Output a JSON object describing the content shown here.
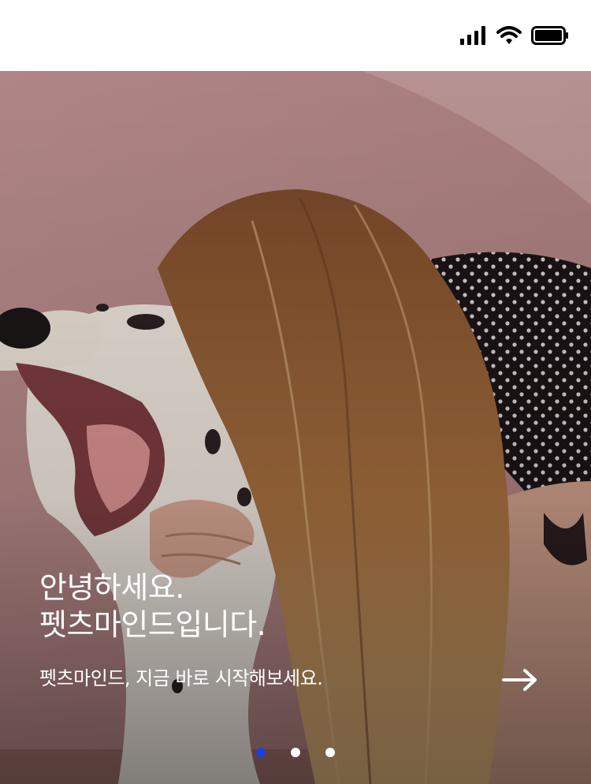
{
  "status_bar": {
    "icons": [
      "signal-bars-icon",
      "wifi-icon",
      "battery-icon"
    ]
  },
  "hero": {
    "image": "photo of a woman with long hair hugging a dalmatian dog",
    "title_line_1": "안녕하세요.",
    "title_line_2": "펫츠마인드입니다.",
    "subtitle": "펫츠마인드, 지금 바로 시작해보세요.",
    "next_icon": "arrow-right-icon"
  },
  "pager": {
    "pages": 3,
    "active_index": 0,
    "active_color": "#1f3ee0",
    "inactive_color": "#ffffff"
  }
}
